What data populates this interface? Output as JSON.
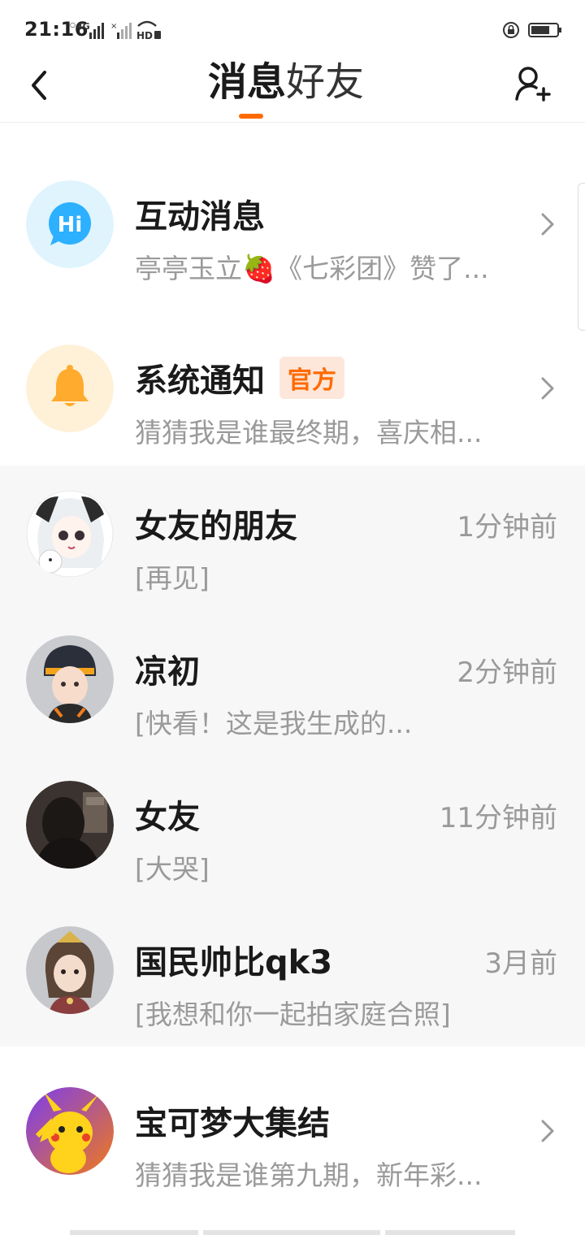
{
  "status_bar": {
    "time": "21:16",
    "network": "4G",
    "hd_label": "HD",
    "icons": [
      "signal-icon",
      "signal-icon",
      "hd-icon",
      "rotation-lock-icon",
      "battery-icon"
    ]
  },
  "header": {
    "tabs": [
      {
        "label": "消息",
        "active": true
      },
      {
        "label": "好友",
        "active": false
      }
    ],
    "accent_color": "#ff6a00"
  },
  "messages": [
    {
      "title": "互动消息",
      "subtitle": "亭亭玉立🍓《七彩团》赞了...",
      "avatar_icon": "hi-chat-icon",
      "avatar_bg": "#dff4fd"
    },
    {
      "title": "系统通知",
      "badge": "官方",
      "subtitle": "猜猜我是谁最终期，喜庆相...",
      "avatar_icon": "bell-icon",
      "avatar_bg": "#fff1d8"
    },
    {
      "title": "女友的朋友",
      "time": "1分钟前",
      "subtitle": "[再见]"
    },
    {
      "title": "凉初",
      "time": "2分钟前",
      "subtitle": "[快看！这是我生成的..."
    },
    {
      "title": "女友",
      "time": "11分钟前",
      "subtitle": "[大哭]"
    },
    {
      "title": "国民帅比qk3",
      "time": "3月前",
      "subtitle": "[我想和你一起拍家庭合照]"
    },
    {
      "title": "宝可梦大集结",
      "subtitle": "猜猜我是谁第九期，新年彩..."
    }
  ]
}
